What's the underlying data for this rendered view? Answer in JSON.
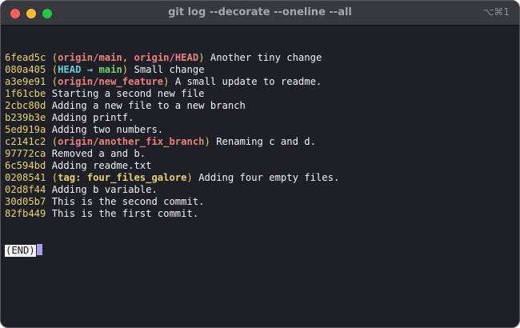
{
  "window": {
    "title": "git log --decorate --oneline --all",
    "shortcut": "⌥⌘1"
  },
  "log": [
    {
      "hash": "6fead5c",
      "decor": [
        {
          "t": "origin/main",
          "k": "remote"
        },
        {
          "t": "origin/HEAD",
          "k": "remote"
        }
      ],
      "message": "Another tiny change"
    },
    {
      "hash": "080a405",
      "decor": [
        {
          "t": "HEAD → ",
          "k": "head"
        },
        {
          "t": "main",
          "k": "local"
        }
      ],
      "joined": true,
      "message": "Small change"
    },
    {
      "hash": "a3e9e91",
      "decor": [
        {
          "t": "origin/new_feature",
          "k": "remote"
        }
      ],
      "message": "A small update to readme."
    },
    {
      "hash": "1f61cbe",
      "message": "Starting a second new file"
    },
    {
      "hash": "2cbc80d",
      "message": "Adding a new file to a new branch"
    },
    {
      "hash": "b239b3e",
      "message": "Adding printf."
    },
    {
      "hash": "5ed919a",
      "message": "Adding two numbers."
    },
    {
      "hash": "c2141c2",
      "decor": [
        {
          "t": "origin/another_fix_branch",
          "k": "remote"
        }
      ],
      "message": "Renaming c and d."
    },
    {
      "hash": "97772ca",
      "message": "Removed a and b."
    },
    {
      "hash": "6c594bd",
      "message": "Adding readme.txt"
    },
    {
      "hash": "0208541",
      "decor": [
        {
          "t": "tag: four_files_galore",
          "k": "tag"
        }
      ],
      "message": "Adding four empty files."
    },
    {
      "hash": "02d8f44",
      "message": "Adding b variable."
    },
    {
      "hash": "30d05b7",
      "message": "This is the second commit."
    },
    {
      "hash": "82fb449",
      "message": "This is the first commit."
    }
  ],
  "pager": {
    "end_label": "(END)"
  },
  "colors": {
    "background": "#1f1f27",
    "hash": "#e7d46a",
    "remote": "#e8827f",
    "head": "#62cfd6",
    "local_branch": "#72d46a",
    "cursor": "#a99ce8"
  }
}
